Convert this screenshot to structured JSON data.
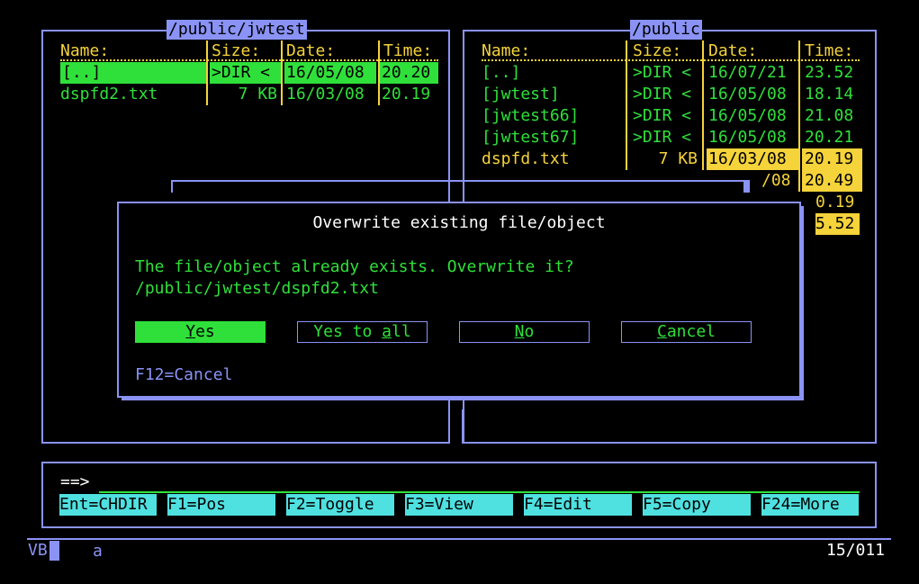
{
  "left_panel": {
    "title": "/public/jwtest",
    "headers": {
      "name": "Name:",
      "size": "Size:",
      "date": "Date:",
      "time": "Time:"
    },
    "rows": [
      {
        "name": "[..]",
        "size": ">DIR <",
        "date": "16/05/08",
        "time": "20.20"
      },
      {
        "name": "dspfd2.txt",
        "size": "7 KB",
        "date": "16/03/08",
        "time": "20.19"
      }
    ]
  },
  "right_panel": {
    "title": "/public",
    "headers": {
      "name": "Name:",
      "size": "Size:",
      "date": "Date:",
      "time": "Time:"
    },
    "rows": [
      {
        "name": "[..]",
        "size": ">DIR <",
        "date": "16/07/21",
        "time": "23.52"
      },
      {
        "name": "[jwtest]",
        "size": ">DIR <",
        "date": "16/05/08",
        "time": "18.14"
      },
      {
        "name": "[jwtest66]",
        "size": ">DIR <",
        "date": "16/05/08",
        "time": "21.08"
      },
      {
        "name": "[jwtest67]",
        "size": ">DIR <",
        "date": "16/05/08",
        "time": "20.21"
      },
      {
        "name": "dspfd.txt",
        "size": "7 KB",
        "date": "16/03/08",
        "time": "20.19"
      }
    ],
    "partial_rows": [
      {
        "date": "/08",
        "time": "20.49"
      },
      {
        "time": "0.19"
      },
      {
        "time": "5.52"
      }
    ]
  },
  "dialog": {
    "title": "Overwrite existing file/object",
    "message": "The file/object already exists. Overwrite it?",
    "path": "/public/jwtest/dspfd2.txt",
    "buttons": {
      "yes": {
        "mnemonic": "Y",
        "rest": "es"
      },
      "yes_all": {
        "before": "Yes to ",
        "mnemonic": "a",
        "rest": "ll"
      },
      "no": {
        "mnemonic": "N",
        "rest": "o"
      },
      "cancel": {
        "mnemonic": "C",
        "rest": "ancel"
      }
    },
    "hint": "F12=Cancel"
  },
  "command": {
    "prompt": "==>",
    "value": ""
  },
  "function_keys": [
    "Ent=CHDIR",
    "F1=Pos",
    "F2=Toggle",
    "F3=View",
    "F4=Edit",
    "F5=Copy",
    "F24=More"
  ],
  "status": {
    "left": "VB",
    "indicator": "a",
    "position": "15/011"
  },
  "colors": {
    "border": "#8a93f5",
    "yellow": "#f5d33a",
    "green": "#2fe03a",
    "cyan": "#4fe0e0"
  }
}
